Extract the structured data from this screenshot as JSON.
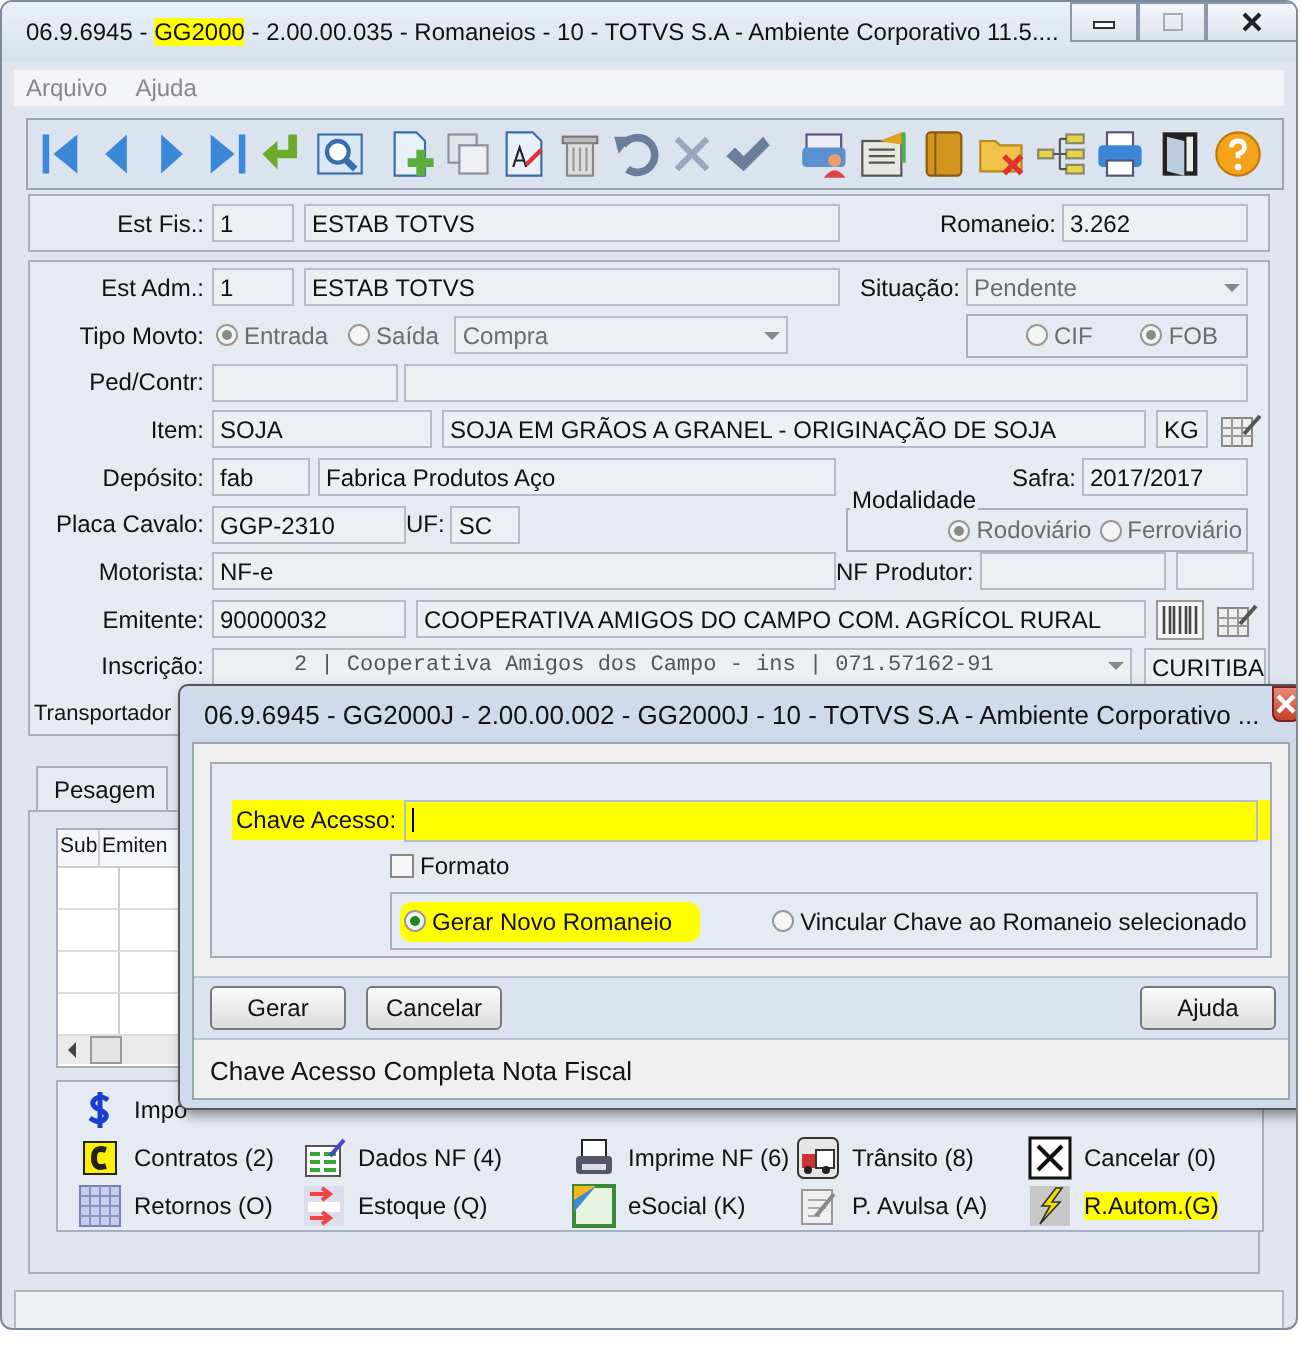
{
  "window": {
    "title": [
      {
        "text": "06.9.6945 - ",
        "highlighted": false
      },
      {
        "text": "GG2000",
        "highlighted": true
      },
      {
        "text": " - 2.00.00.035 - Romaneios - 10 - TOTVS S.A - Ambiente Corporativo 11.5....",
        "highlighted": false
      }
    ]
  },
  "menu": [
    {
      "label": "Arquivo",
      "disabled": true
    },
    {
      "label": "Ajuda",
      "disabled": true
    }
  ],
  "header": {
    "est_fis_label": "Est Fis.:",
    "est_fis_code": "1",
    "est_fis_name": "ESTAB TOTVS",
    "romaneio_label": "Romaneio:",
    "romaneio": "3.262"
  },
  "form": {
    "est_adm": {
      "label": "Est Adm.:",
      "code": "1",
      "name": "ESTAB TOTVS"
    },
    "situacao": {
      "label": "Situação:",
      "value": "Pendente"
    },
    "tipo_movto": {
      "label": "Tipo Movto:",
      "disabled": true,
      "options": [
        {
          "label": "Entrada",
          "selected": true
        },
        {
          "label": "Saída",
          "selected": false
        }
      ],
      "combo": "Compra"
    },
    "frete": {
      "disabled": true,
      "options": [
        {
          "label": "CIF",
          "selected": false
        },
        {
          "label": "FOB",
          "selected": true
        }
      ]
    },
    "ped_contr": {
      "label": "Ped/Contr:"
    },
    "item": {
      "label": "Item:",
      "code": "SOJA",
      "description": "SOJA EM GRÃOS A GRANEL - ORIGINAÇÃO DE SOJA",
      "unit": "KG"
    },
    "deposito": {
      "label": "Depósito:",
      "code": "fab",
      "name": "Fabrica Produtos Aço"
    },
    "safra": {
      "label": "Safra:",
      "value": "2017/2017"
    },
    "placa": {
      "label": "Placa Cavalo:",
      "value": "GGP-2310"
    },
    "uf": {
      "label": "UF:",
      "value": "SC"
    },
    "modalidade": {
      "title": "Modalidade",
      "disabled": true,
      "options": [
        {
          "label": "Rodoviário",
          "selected": true
        },
        {
          "label": "Ferroviário",
          "selected": false
        }
      ]
    },
    "motorista": {
      "label": "Motorista:",
      "value": "NF-e"
    },
    "nf_produtor": {
      "label": "NF Produtor:"
    },
    "emitente": {
      "label": "Emitente:",
      "code": "90000032",
      "name": "COOPERATIVA AMIGOS DO CAMPO COM. AGRÍCOL RURAL"
    },
    "inscricao": {
      "label": "Inscrição:",
      "value": "2 | Cooperativa Amigos dos Campo - ins | 071.57162-91",
      "city": "CURITIBA"
    },
    "transportador": {
      "label": "Transportador"
    }
  },
  "tabs": [
    {
      "label": "Pesagem",
      "selected": true
    }
  ],
  "table": {
    "columns": [
      "Sub",
      "Emiten"
    ]
  },
  "actions": [
    [
      {
        "kind": "dollar",
        "label": "Impo",
        "highlighted": false
      }
    ],
    [
      {
        "kind": "contract",
        "label": "Contratos (2)",
        "highlighted": false
      },
      {
        "kind": "data",
        "label": "Dados NF (4)",
        "highlighted": false
      },
      {
        "kind": "print",
        "label": "Imprime NF (6)",
        "highlighted": false
      },
      {
        "kind": "transit",
        "label": "Trânsito (8)",
        "highlighted": false
      },
      {
        "kind": "cancel",
        "label": "Cancelar (0)",
        "highlighted": false
      }
    ],
    [
      {
        "kind": "calendar",
        "label": "Retornos (O)",
        "highlighted": false
      },
      {
        "kind": "stock",
        "label": "Estoque (Q)",
        "highlighted": false
      },
      {
        "kind": "esocial",
        "label": "eSocial (K)",
        "highlighted": false
      },
      {
        "kind": "avulsa",
        "label": "P. Avulsa (A)",
        "highlighted": false
      },
      {
        "kind": "auto",
        "label": "R.Autom.(G)",
        "highlighted": true
      }
    ]
  ],
  "dialog": {
    "title": "06.9.6945 - GG2000J - 2.00.00.002 - GG2000J - 10 - TOTVS S.A - Ambiente Corporativo ...",
    "chave": {
      "label": "Chave Acesso:",
      "highlighted": true
    },
    "formato": {
      "label": "Formato",
      "checked": false
    },
    "options": [
      {
        "label": "Gerar Novo Romaneio",
        "selected": true,
        "highlighted": true
      },
      {
        "label": "Vincular Chave ao Romaneio selecionado",
        "selected": false,
        "highlighted": false
      }
    ],
    "buttons": [
      "Gerar",
      "Cancelar",
      "Ajuda"
    ],
    "status": "Chave Acesso Completa Nota Fiscal"
  }
}
